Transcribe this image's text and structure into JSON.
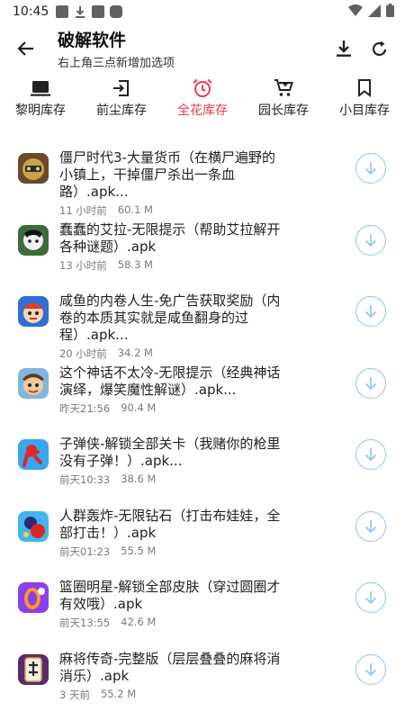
{
  "status_bar": {
    "time": "10:45"
  },
  "header": {
    "title": "破解软件",
    "subtitle": "右上角三点新增加选项"
  },
  "tabs": [
    {
      "label": "黎明库存",
      "icon": "laptop-icon"
    },
    {
      "label": "前尘库存",
      "icon": "login-icon"
    },
    {
      "label": "全花库存",
      "icon": "alarm-icon",
      "active": true
    },
    {
      "label": "园长库存",
      "icon": "cart-icon"
    },
    {
      "label": "小目库存",
      "icon": "bookmark-icon"
    }
  ],
  "colors": {
    "accent": "#f03a4a",
    "download_ring": "#8fc3f0",
    "meta": "#7a7a7a"
  },
  "items": [
    {
      "name": "僵尸时代3-大量货币（在横尸遍野的小镇上，干掉僵尸杀出一条血路）.apk...",
      "time": "11 小时前",
      "size": "60.1 M"
    },
    {
      "name": "蠢蠢的艾拉-无限提示（帮助艾拉解开各种谜题）.apk",
      "time": "13 小时前",
      "size": "58.3 M"
    },
    {
      "name": "咸鱼的内卷人生-免广告获取奖励（内卷的本质其实就是咸鱼翻身的过程）.apk...",
      "time": "20 小时前",
      "size": "34.2 M"
    },
    {
      "name": "这个神话不太冷-无限提示（经典神话演绎，爆笑魔性解谜）.apk...",
      "time": "昨天21:56",
      "size": "90.4 M"
    },
    {
      "name": "子弹侠-解锁全部关卡（我赌你的枪里没有子弹！）.apk...",
      "time": "前天10:33",
      "size": "38.6 M"
    },
    {
      "name": "人群轰炸-无限钻石（打击布娃娃，全部打击！）.apk",
      "time": "前天01:23",
      "size": "55.5 M"
    },
    {
      "name": "篮圈明星-解锁全部皮肤（穿过圆圈才有效哦）.apk",
      "time": "前天13:55",
      "size": "42.6 M"
    },
    {
      "name": "麻将传奇-完整版（层层叠叠的麻将消消乐）.apk",
      "time": "3 天前",
      "size": "55.2 M"
    }
  ]
}
